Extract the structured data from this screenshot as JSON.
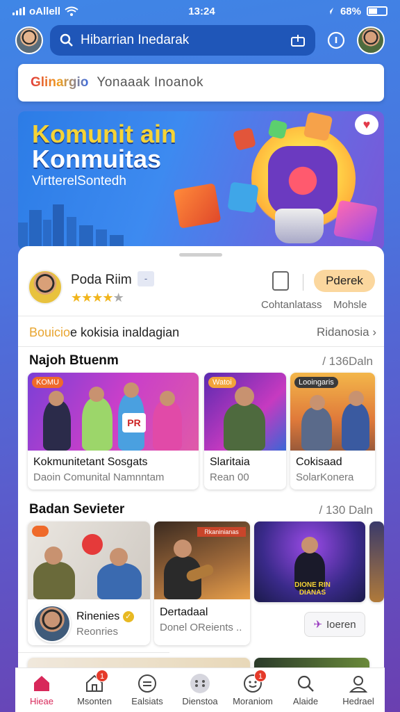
{
  "status": {
    "left": "oAllell",
    "time": "13:24",
    "battery": "68%"
  },
  "search": {
    "placeholder": "Hibarrian Inedarak"
  },
  "promo": {
    "brand": "Glinargio",
    "text": "Yonaaak Inoanok"
  },
  "banner": {
    "title1": "Komunit ain",
    "title2": "Konmuitas",
    "subtitle": "VirtterelSontedh"
  },
  "profile": {
    "name": "Poda Riim",
    "tag": "-",
    "rating": 4,
    "label_a": "Cohtanlatass",
    "label_b": "Mohsle",
    "follow_label": "Pderek"
  },
  "notice": {
    "highlight": "Bouicio",
    "text": "e kokisia inaldagian",
    "link": "Ridanosia",
    "chevron": "›"
  },
  "section1": {
    "title": "Najoh Btuenm",
    "count": "/ 136Daln",
    "cards": [
      {
        "title": "Kokmunitetant Sosgats",
        "sub": "Daoin Comunital Namnntam",
        "chip": "KOMU",
        "sign": "PR"
      },
      {
        "title": "Slaritaia",
        "sub": "Rean 00",
        "chip": "Watoi"
      },
      {
        "title": "Cokisaad",
        "sub": "SolarKonera",
        "chip": "Looingaris"
      }
    ]
  },
  "section2": {
    "title": "Badan Sevieter",
    "count": "/ 130 Daln",
    "cards": [
      {
        "title": "Rinenies",
        "sub": "Reonries"
      },
      {
        "title": "Dertadaal",
        "sub": "Donel OReients ..",
        "sign": "Rkaninianas"
      },
      {
        "title": "",
        "sub": "",
        "sign": "DIONE RIN DIANAS"
      }
    ],
    "listen_label": "Ioeren"
  },
  "nav": [
    {
      "label": "Hieae",
      "icon": "home-icon",
      "active": true
    },
    {
      "label": "Msonten",
      "icon": "house-outline-icon",
      "badge": "1"
    },
    {
      "label": "Ealsiats",
      "icon": "grid-circle-icon"
    },
    {
      "label": "Dienstoa",
      "icon": "dots-circle-icon"
    },
    {
      "label": "Moraniom",
      "icon": "chat-face-icon",
      "badge": "1"
    },
    {
      "label": "Alaide",
      "icon": "search-icon"
    },
    {
      "label": "Hedrael",
      "icon": "profile-icon"
    }
  ],
  "colors": {
    "accent": "#d8285a",
    "search_bg": "#1f56b8",
    "follow_bg": "#fbd79e",
    "star": "#f1b51c"
  }
}
